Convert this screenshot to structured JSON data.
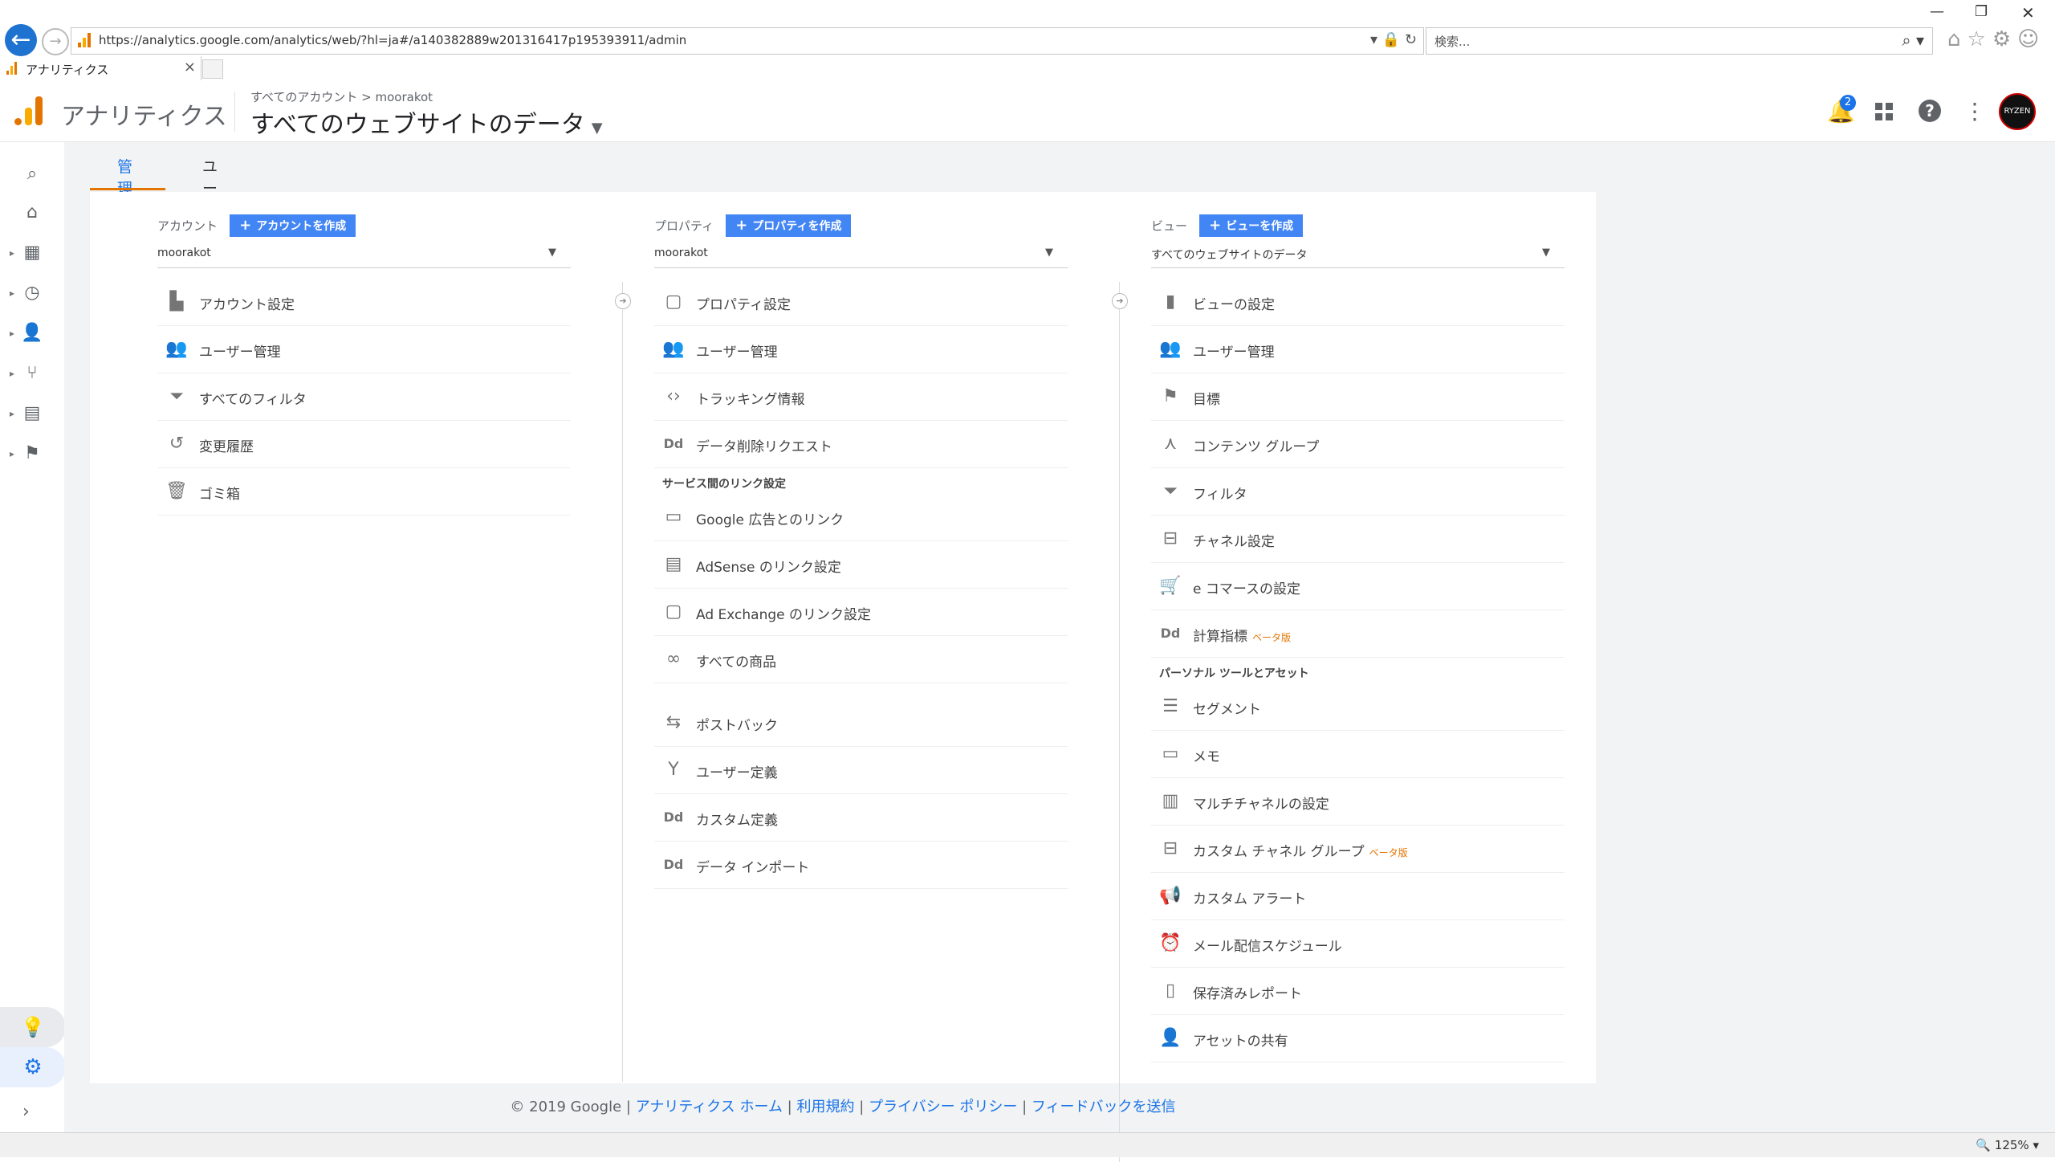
{
  "browser": {
    "url": "https://analytics.google.com/analytics/web/?hl=ja#/a140382889w201316417p195393911/admin",
    "search_placeholder": "検索...",
    "tab_title": "アナリティクス",
    "tab_close": "×",
    "zoom": "125%"
  },
  "header": {
    "product_name": "アナリティクス",
    "breadcrumb_root": "すべてのアカウント",
    "breadcrumb_sep": ">",
    "breadcrumb_account": "moorakot",
    "view_title": "すべてのウェブサイトのデータ",
    "notification_count": "2",
    "avatar_text": "RYZEN"
  },
  "subtabs": {
    "admin": "管理",
    "user": "ユーザー"
  },
  "account_col": {
    "label": "アカウント",
    "create_label": "アカウントを作成",
    "selected": "moorakot",
    "items": [
      {
        "label": "アカウント設定",
        "icon": "building-icon"
      },
      {
        "label": "ユーザー管理",
        "icon": "people-icon"
      },
      {
        "label": "すべてのフィルタ",
        "icon": "filter-icon"
      },
      {
        "label": "変更履歴",
        "icon": "history-icon"
      },
      {
        "label": "ゴミ箱",
        "icon": "trash-icon"
      }
    ]
  },
  "property_col": {
    "label": "プロパティ",
    "create_label": "プロパティを作成",
    "selected": "moorakot",
    "items": [
      {
        "label": "プロパティ設定",
        "icon": "property-settings-icon"
      },
      {
        "label": "ユーザー管理",
        "icon": "people-icon"
      },
      {
        "label": "トラッキング情報",
        "icon": "code-icon"
      },
      {
        "label": "データ削除リクエスト",
        "icon": "dd-icon"
      }
    ],
    "section_links": "サービス間のリンク設定",
    "links": [
      {
        "label": "Google 広告とのリンク",
        "icon": "ads-link-icon"
      },
      {
        "label": "AdSense のリンク設定",
        "icon": "adsense-icon"
      },
      {
        "label": "Ad Exchange のリンク設定",
        "icon": "adexchange-icon"
      },
      {
        "label": "すべての商品",
        "icon": "products-icon"
      }
    ],
    "more": [
      {
        "label": "ポストバック",
        "icon": "postback-icon"
      },
      {
        "label": "ユーザー定義",
        "icon": "user-definition-icon"
      },
      {
        "label": "カスタム定義",
        "icon": "dd-icon"
      },
      {
        "label": "データ インポート",
        "icon": "dd-icon"
      }
    ]
  },
  "view_col": {
    "label": "ビュー",
    "create_label": "ビューを作成",
    "selected": "すべてのウェブサイトのデータ",
    "items": [
      {
        "label": "ビューの設定",
        "icon": "document-icon"
      },
      {
        "label": "ユーザー管理",
        "icon": "people-icon"
      },
      {
        "label": "目標",
        "icon": "flag-icon"
      },
      {
        "label": "コンテンツ グループ",
        "icon": "content-group-icon"
      },
      {
        "label": "フィルタ",
        "icon": "filter-icon"
      },
      {
        "label": "チャネル設定",
        "icon": "channel-icon"
      },
      {
        "label": "e コマースの設定",
        "icon": "cart-icon"
      },
      {
        "label": "計算指標",
        "icon": "dd-icon",
        "beta": "ベータ版"
      }
    ],
    "section_personal": "パーソナル ツールとアセット",
    "personal": [
      {
        "label": "セグメント",
        "icon": "segment-icon"
      },
      {
        "label": "メモ",
        "icon": "memo-icon"
      },
      {
        "label": "マルチチャネルの設定",
        "icon": "bar-chart-icon"
      },
      {
        "label": "カスタム チャネル グループ",
        "icon": "channel-icon",
        "beta": "ベータ版"
      },
      {
        "label": "カスタム アラート",
        "icon": "megaphone-icon"
      },
      {
        "label": "メール配信スケジュール",
        "icon": "alarm-icon"
      },
      {
        "label": "保存済みレポート",
        "icon": "saved-report-icon"
      },
      {
        "label": "アセットの共有",
        "icon": "person-add-icon"
      }
    ]
  },
  "beta_label": "ベータ版",
  "footer": {
    "copyright": "© 2019 Google",
    "sep": "|",
    "home": "アナリティクス ホーム",
    "terms": "利用規約",
    "privacy": "プライバシー ポリシー",
    "feedback": "フィードバックを送信"
  }
}
